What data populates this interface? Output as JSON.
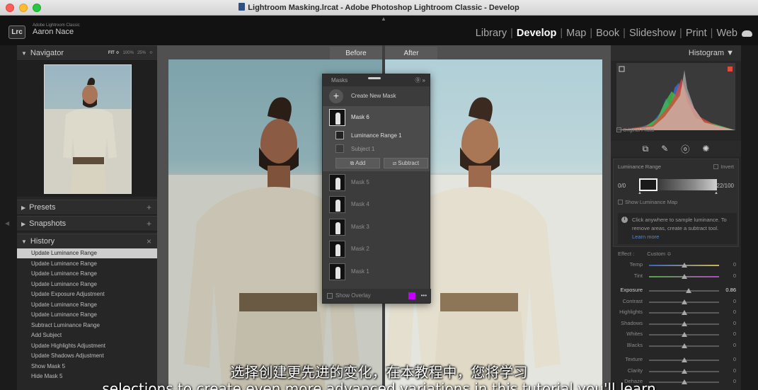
{
  "window": {
    "title": "Lightroom Masking.lrcat - Adobe Photoshop Lightroom Classic - Develop"
  },
  "identity": {
    "logo": "Lrc",
    "app": "Adobe Lightroom Classic",
    "user": "Aaron Nace"
  },
  "modules": [
    "Library",
    "Develop",
    "Map",
    "Book",
    "Slideshow",
    "Print",
    "Web"
  ],
  "active_module": "Develop",
  "left_panel": {
    "navigator": {
      "title": "Navigator",
      "zoom_fit": "FIT ≎",
      "zoom_100": "100%",
      "zoom_25": "25%",
      "zoom_more": "≎"
    },
    "presets": {
      "title": "Presets",
      "action": "+"
    },
    "snapshots": {
      "title": "Snapshots",
      "action": "+"
    },
    "history": {
      "title": "History",
      "action": "×",
      "items": [
        "Update Luminance Range",
        "Update Luminance Range",
        "Update Luminance Range",
        "Update Luminance Range",
        "Update Exposure Adjustment",
        "Update Luminance Range",
        "Update Luminance Range",
        "Subtract Luminance Range",
        "Add Subject",
        "Update Highlights Adjustment",
        "Update Shadows Adjustment",
        "Show Mask 5",
        "Hide Mask 5"
      ]
    }
  },
  "center": {
    "before_label": "Before",
    "after_label": "After"
  },
  "masks_panel": {
    "title": "Masks",
    "create_new": "Create New Mask",
    "active_mask": "Mask 6",
    "components": [
      "Luminance Range 1",
      "Subject 1"
    ],
    "add_label": "Add",
    "subtract_label": "Subtract",
    "other_masks": [
      "Mask 5",
      "Mask 4",
      "Mask 3",
      "Mask 2",
      "Mask 1"
    ],
    "show_overlay": "Show Overlay",
    "overlay_color": "#c400ff"
  },
  "right_panel": {
    "histogram_title": "Histogram",
    "original_photo": "Original Photo",
    "luminance": {
      "title": "Luminance Range",
      "invert": "Invert",
      "low": "0/0",
      "high": "22/100",
      "show_map": "Show Luminance Map",
      "help": "Click anywhere to sample luminance. To remove areas, create a subtract tool.",
      "learn_more": "Learn more"
    },
    "effect": {
      "label": "Effect :",
      "preset": "Custom ≎"
    },
    "sliders": [
      {
        "label": "Temp",
        "value": "0",
        "position": 0.5,
        "track": "temp"
      },
      {
        "label": "Tint",
        "value": "0",
        "position": 0.5,
        "track": "tint"
      },
      {
        "label": "Exposure",
        "value": "0.86",
        "position": 0.57,
        "track": "plain",
        "active": true,
        "gap": true
      },
      {
        "label": "Contrast",
        "value": "0",
        "position": 0.5,
        "track": "plain"
      },
      {
        "label": "Highlights",
        "value": "0",
        "position": 0.5,
        "track": "plain"
      },
      {
        "label": "Shadows",
        "value": "0",
        "position": 0.5,
        "track": "plain"
      },
      {
        "label": "Whites",
        "value": "0",
        "position": 0.5,
        "track": "plain"
      },
      {
        "label": "Blacks",
        "value": "0",
        "position": 0.5,
        "track": "plain"
      },
      {
        "label": "Texture",
        "value": "0",
        "position": 0.5,
        "track": "plain",
        "gap": true
      },
      {
        "label": "Clarity",
        "value": "0",
        "position": 0.5,
        "track": "plain"
      },
      {
        "label": "Dehaze",
        "value": "0",
        "position": 0.5,
        "track": "plain"
      }
    ]
  },
  "subtitles": {
    "chinese": "选择创建更先进的变化，在本教程中，您将学习",
    "english": "selections to create even more advanced variations in this tutorial you'll learn"
  }
}
